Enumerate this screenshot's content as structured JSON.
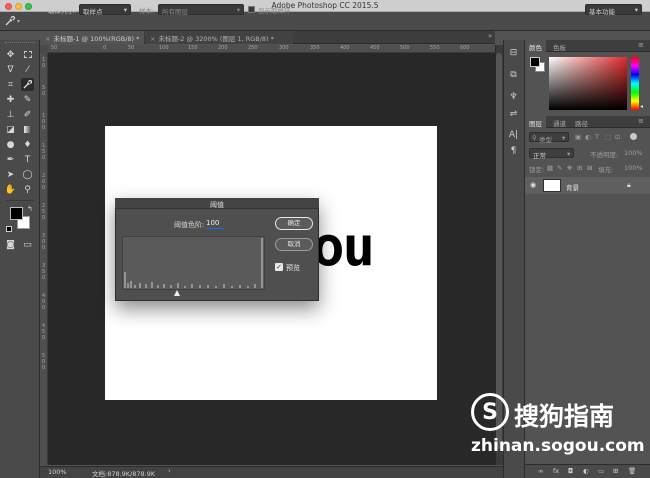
{
  "app": {
    "title": "Adobe Photoshop CC 2015.5"
  },
  "colors": {
    "accent_blue": "#1473e6",
    "pasteboard": "#282828",
    "panel": "#535353",
    "foreground_swatch": "#000000",
    "background_swatch": "#ffffff"
  },
  "options_bar": {
    "sample_size_label": "取样大小:",
    "sample_size_value": "取样点",
    "sample_label": "样本:",
    "sample_value": "所有图层",
    "show_ring_label": "显示取样环",
    "workspace": "基本功能"
  },
  "document_tabs": [
    {
      "label": "未标题-1 @ 100%(RGB/8) *"
    },
    {
      "label": "未标题-2 @ 3200% (图层 1, RGB/8) *"
    }
  ],
  "rulers": {
    "top": [
      "50",
      "0",
      "50",
      "100",
      "150",
      "200",
      "250",
      "300",
      "350",
      "400",
      "450",
      "500",
      "550",
      "600"
    ],
    "left": [
      "1",
      "0",
      "5",
      "0",
      "1",
      "0",
      "0",
      "1",
      "5",
      "0",
      "2",
      "0",
      "0",
      "2",
      "5",
      "0",
      "3",
      "0",
      "0",
      "3",
      "5",
      "0",
      "4",
      "0",
      "0",
      "4",
      "5",
      "0",
      "5",
      "0",
      "0"
    ]
  },
  "canvas": {
    "text": "ou"
  },
  "threshold_dialog": {
    "title": "阈值",
    "level_label": "阈值色阶:",
    "level_value": "100",
    "ok_label": "确定",
    "cancel_label": "取消",
    "preview_label": "预览",
    "preview_checked": true
  },
  "status_bar": {
    "zoom": "100%",
    "doc_info": "文档:878.9K/878.9K"
  },
  "color_panel": {
    "tabs": [
      "颜色",
      "色板"
    ]
  },
  "layers_panel": {
    "tabs": [
      "图层",
      "通道",
      "路径"
    ],
    "kind_filter": "类型",
    "blend_mode": "正常",
    "opacity_label": "不透明度:",
    "opacity_value": "100%",
    "lock_label": "锁定:",
    "fill_label": "填充:",
    "fill_value": "100%",
    "layers": [
      {
        "name": "背景"
      }
    ]
  },
  "watermark": {
    "name": "搜狗指南",
    "url": "zhinan.sogou.com"
  }
}
